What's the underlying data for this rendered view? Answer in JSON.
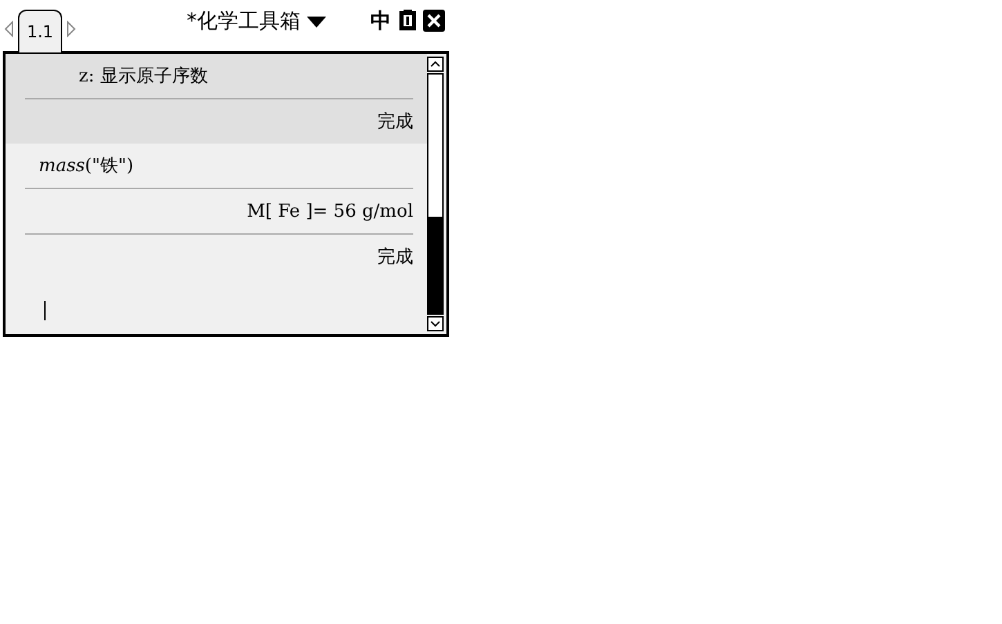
{
  "tab": {
    "label": "1.1",
    "selected": true
  },
  "document": {
    "title": "*化学工具箱",
    "language": "中"
  },
  "entries": [
    {
      "input": "z: 显示原子序数",
      "indented": true,
      "selected": true,
      "outputs": [
        "完成"
      ]
    },
    {
      "input": "*mass*(\"铁\")",
      "indented": false,
      "selected": false,
      "outputs": [
        "M[ Fe ]= 56 g/mol",
        "完成"
      ]
    }
  ]
}
